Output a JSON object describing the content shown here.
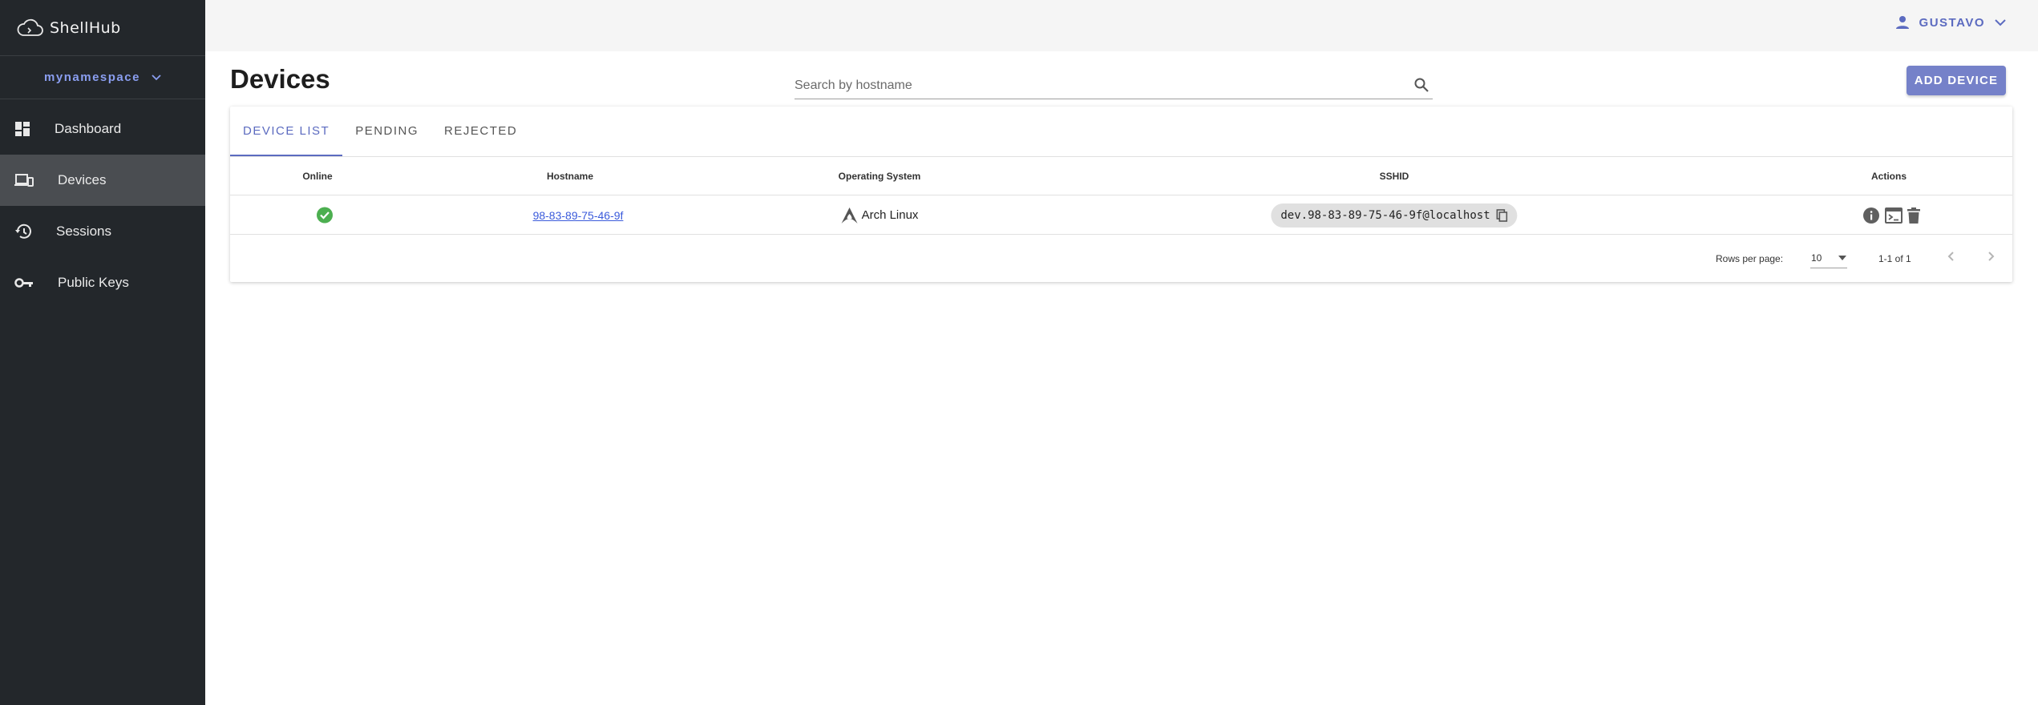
{
  "app": {
    "name": "ShellHub"
  },
  "sidebar": {
    "namespace": "mynamespace",
    "items": [
      {
        "label": "Dashboard",
        "icon": "dashboard-icon"
      },
      {
        "label": "Devices",
        "icon": "devices-icon",
        "active": true
      },
      {
        "label": "Sessions",
        "icon": "history-icon"
      },
      {
        "label": "Public Keys",
        "icon": "key-icon"
      }
    ]
  },
  "header": {
    "user": "GUSTAVO"
  },
  "main": {
    "title": "Devices",
    "search_placeholder": "Search by hostname",
    "add_button": "ADD DEVICE",
    "tabs": [
      {
        "label": "DEVICE LIST",
        "active": true
      },
      {
        "label": "PENDING"
      },
      {
        "label": "REJECTED"
      }
    ],
    "table": {
      "columns": [
        "Online",
        "Hostname",
        "Operating System",
        "SSHID",
        "Actions"
      ],
      "rows": [
        {
          "online": true,
          "hostname": "98-83-89-75-46-9f",
          "os": "Arch Linux",
          "sshid": "dev.98-83-89-75-46-9f@localhost",
          "actions": [
            "info-icon",
            "terminal-icon",
            "delete-icon"
          ]
        }
      ]
    },
    "pagination": {
      "rows_per_page_label": "Rows per page:",
      "rows_per_page": "10",
      "range": "1-1 of 1"
    }
  },
  "colors": {
    "sidebar_bg": "#23272b",
    "accent": "#5c6bc0",
    "button": "#7581c9",
    "online": "#4caf50"
  }
}
